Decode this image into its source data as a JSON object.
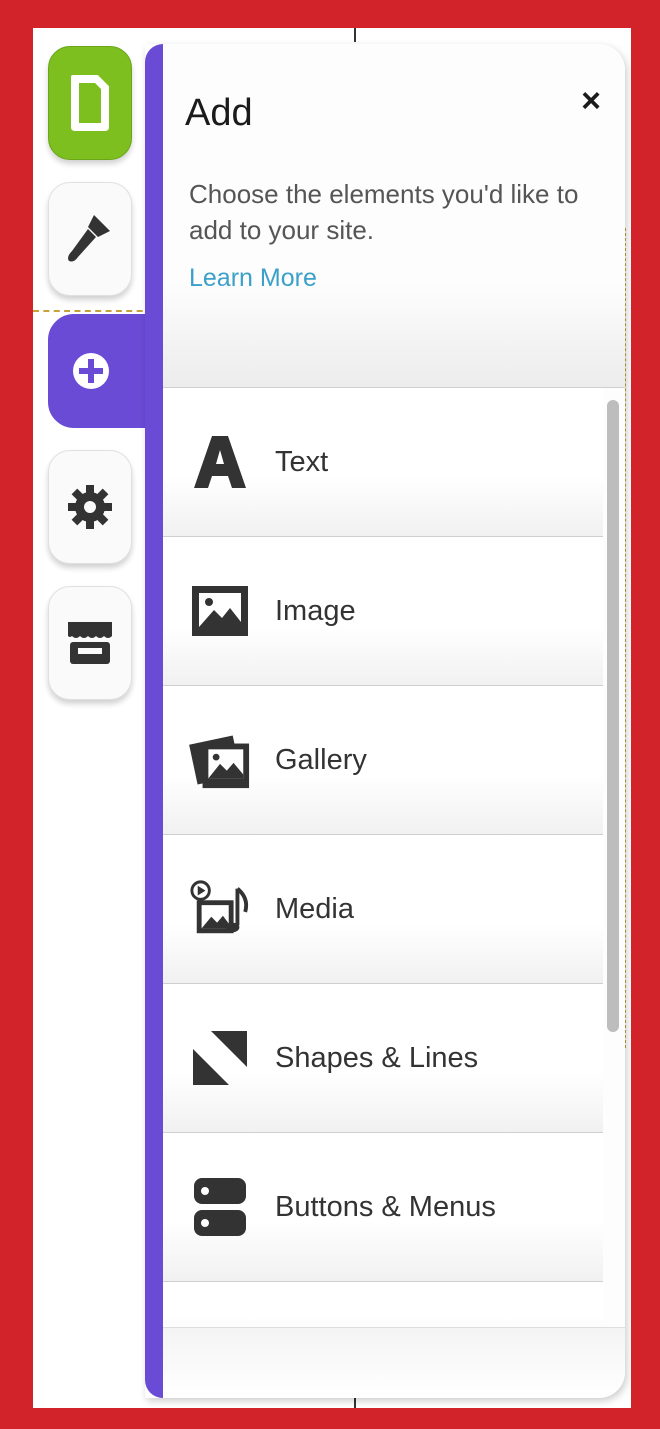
{
  "panel": {
    "title": "Add",
    "close_symbol": "×",
    "description": "Choose the elements you'd like to add to your site.",
    "learn_more": "Learn More"
  },
  "rail": {
    "items": [
      {
        "name": "pages",
        "icon": "page-icon"
      },
      {
        "name": "design",
        "icon": "brush-icon"
      },
      {
        "name": "add",
        "icon": "plus-circle-icon",
        "active": true
      },
      {
        "name": "settings",
        "icon": "gear-icon"
      },
      {
        "name": "store",
        "icon": "store-icon"
      }
    ]
  },
  "list": {
    "items": [
      {
        "label": "Text",
        "icon": "text-icon"
      },
      {
        "label": "Image",
        "icon": "image-icon"
      },
      {
        "label": "Gallery",
        "icon": "gallery-icon"
      },
      {
        "label": "Media",
        "icon": "media-icon"
      },
      {
        "label": "Shapes & Lines",
        "icon": "shapes-icon"
      },
      {
        "label": "Buttons & Menus",
        "icon": "buttons-icon"
      }
    ]
  },
  "colors": {
    "frame": "#d3232a",
    "accent_purple": "#6a4bd6",
    "pages_green": "#7cbf1e",
    "link_blue": "#3aa0c9"
  }
}
